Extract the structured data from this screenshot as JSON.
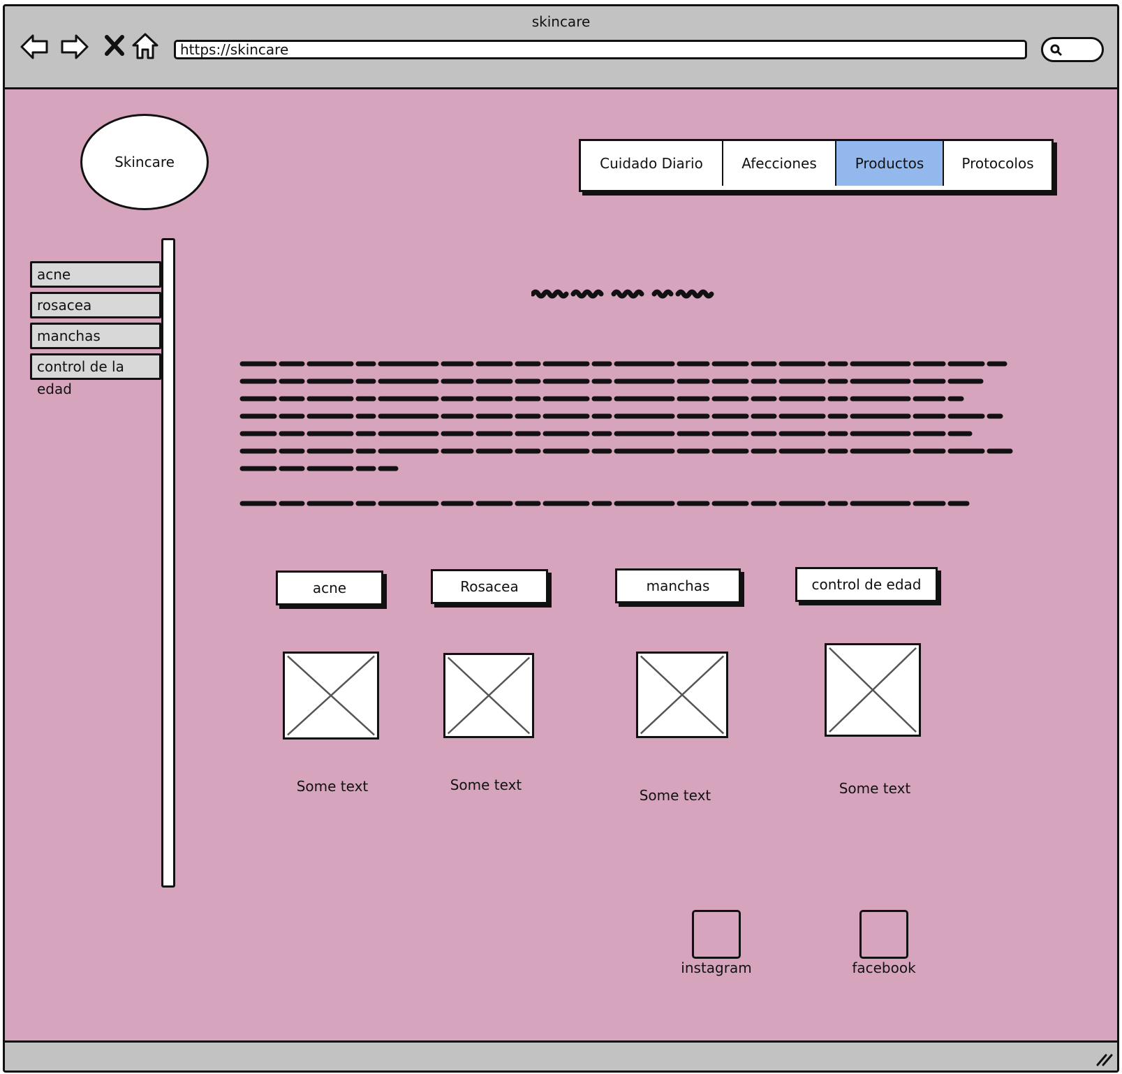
{
  "browser": {
    "window_title": "skincare",
    "url": "https://skincare"
  },
  "logo": {
    "label": "Skincare"
  },
  "nav": {
    "tabs": [
      {
        "label": "Cuidado Diario",
        "active": false
      },
      {
        "label": "Afecciones",
        "active": false
      },
      {
        "label": "Productos",
        "active": true
      },
      {
        "label": "Protocolos",
        "active": false
      }
    ],
    "active_color": "#92b8ee"
  },
  "sidebar": {
    "items": [
      "acne",
      "rosacea",
      "manchas",
      "control de la edad"
    ]
  },
  "categories": [
    {
      "button": "acne",
      "caption": "Some text"
    },
    {
      "button": "Rosacea",
      "caption": "Some text"
    },
    {
      "button": "manchas",
      "caption": "Some text"
    },
    {
      "button": "control de edad",
      "caption": "Some text"
    }
  ],
  "social": [
    {
      "label": "instagram"
    },
    {
      "label": "facebook"
    }
  ],
  "colors": {
    "page_background": "#d6a5bd",
    "chrome": "#c2c2c2"
  }
}
